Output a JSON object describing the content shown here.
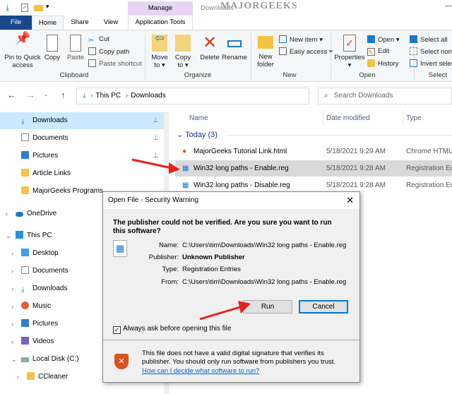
{
  "window": {
    "title": "Downloads",
    "context_tab": "Manage",
    "watermark": "MAJORGEEKS .COM"
  },
  "tabs": [
    {
      "label": "File"
    },
    {
      "label": "Home"
    },
    {
      "label": "Share"
    },
    {
      "label": "View"
    },
    {
      "label": "Application Tools"
    }
  ],
  "ribbon": {
    "clipboard": {
      "pin": "Pin to Quick access",
      "copy": "Copy",
      "paste": "Paste",
      "cut": "Cut",
      "copy_path": "Copy path",
      "paste_shortcut": "Paste shortcut",
      "label": "Clipboard"
    },
    "organize": {
      "move_to": "Move to",
      "copy_to": "Copy to",
      "delete": "Delete",
      "rename": "Rename",
      "label": "Organize"
    },
    "new": {
      "new_folder": "New folder",
      "new_item": "New item",
      "easy_access": "Easy access",
      "label": "New"
    },
    "open": {
      "properties": "Properties",
      "open": "Open",
      "edit": "Edit",
      "history": "History",
      "label": "Open"
    },
    "select": {
      "select_all": "Select all",
      "select_none": "Select none",
      "invert": "Invert selection",
      "label": "Select"
    }
  },
  "address": {
    "crumbs": [
      "This PC",
      "Downloads"
    ],
    "search_placeholder": "Search Downloads"
  },
  "nav": [
    {
      "label": "Downloads",
      "pinned": true,
      "selected": true
    },
    {
      "label": "Documents",
      "pinned": true
    },
    {
      "label": "Pictures",
      "pinned": true
    },
    {
      "label": "Article Links"
    },
    {
      "label": "MajorGeeks Programs"
    },
    {
      "label": "OneDrive"
    },
    {
      "label": "This PC"
    },
    {
      "label": "Desktop"
    },
    {
      "label": "Documents"
    },
    {
      "label": "Downloads"
    },
    {
      "label": "Music"
    },
    {
      "label": "Pictures"
    },
    {
      "label": "Videos"
    },
    {
      "label": "Local Disk (C:)"
    },
    {
      "label": "CCleaner"
    }
  ],
  "files": {
    "columns": [
      "Name",
      "Date modified",
      "Type"
    ],
    "group": "Today (3)",
    "rows": [
      {
        "name": "MajorGeeks Tutorial Link.html",
        "date": "5/18/2021 9:29 AM",
        "type": "Chrome HTML Do"
      },
      {
        "name": "Win32 long paths - Enable.reg",
        "date": "5/18/2021 9:28 AM",
        "type": "Registration Entri",
        "selected": true
      },
      {
        "name": "Win32 long paths - Disable.reg",
        "date": "5/18/2021 9:28 AM",
        "type": "Registration Entri"
      }
    ]
  },
  "dialog": {
    "title": "Open File - Security Warning",
    "question": "The publisher could not be verified.  Are you sure you want to run this software?",
    "fields": [
      {
        "label": "Name:",
        "value": "C:\\Users\\tim\\Downloads\\Win32 long paths - Enable.reg"
      },
      {
        "label": "Publisher:",
        "value": "Unknown Publisher"
      },
      {
        "label": "Type:",
        "value": "Registration Entries"
      },
      {
        "label": "From:",
        "value": "C:\\Users\\tim\\Downloads\\Win32 long paths - Enable.reg"
      }
    ],
    "run": "Run",
    "cancel": "Cancel",
    "checkbox": "Always ask before opening this file",
    "checked": true,
    "warning": "This file does not have a valid digital signature that verifies its publisher.  You should only run software from publishers you trust.",
    "link": "How can I decide what software to run?"
  },
  "colors": {
    "accent": "#1979ca",
    "file_tab": "#19478a",
    "manage": "#e8d5f5",
    "selected": "#cce8ff",
    "arrow": "#e8201d"
  }
}
